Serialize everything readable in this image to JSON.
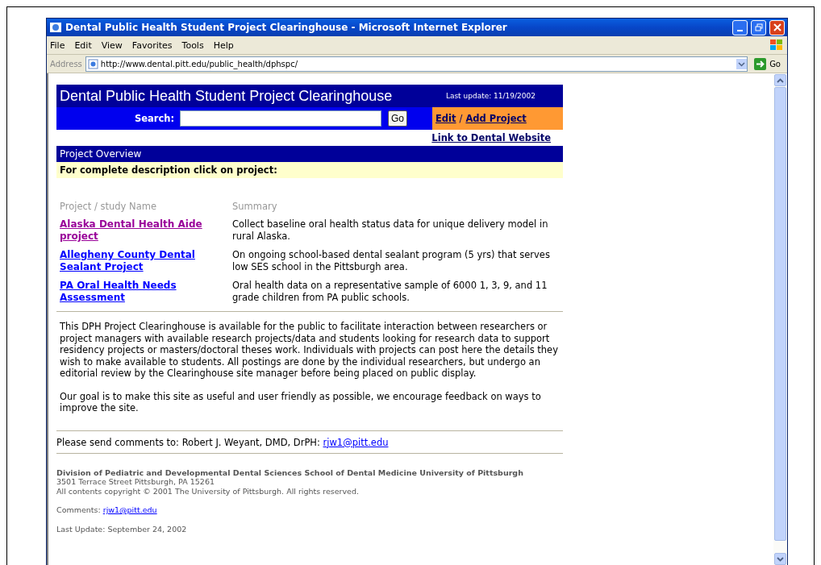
{
  "window": {
    "title": "Dental Public Health Student Project Clearinghouse - Microsoft Internet Explorer",
    "menu": [
      "File",
      "Edit",
      "View",
      "Favorites",
      "Tools",
      "Help"
    ],
    "address_label": "Address",
    "url": "http://www.dental.pitt.edu/public_health/dphspc/",
    "go": "Go"
  },
  "page": {
    "title": "Dental Public Health Student Project Clearinghouse",
    "last_update": "Last update: 11/19/2002",
    "search_label": "Search:",
    "search_button": "Go",
    "edit_link": "Edit",
    "separator": "/",
    "add_link": "Add Project",
    "website_link": "Link to Dental Website",
    "overview": "Project Overview",
    "instruction": "For complete description click on project:",
    "columns": [
      "Project / study Name",
      "Summary"
    ],
    "projects": [
      {
        "name": "Alaska Dental Health Aide project",
        "summary": "Collect baseline oral health status data for unique delivery model in rural Alaska.",
        "visited": true
      },
      {
        "name": "Allegheny County Dental Sealant Project",
        "summary": "On ongoing school-based dental sealant program (5 yrs) that serves low SES school in the Pittsburgh area.",
        "visited": false
      },
      {
        "name": "PA Oral Health Needs Assessment",
        "summary": "Oral health data on a representative sample of 6000 1, 3, 9, and 11 grade children from PA public schools.",
        "visited": false
      }
    ],
    "paragraphs": [
      "This DPH Project Clearinghouse is available for the public to facilitate interaction between researchers or project managers with available research projects/data and students looking for research data to support residency projects or masters/doctoral theses work. Individuals with projects can post here the details they wish to make available to students. All postings are done by the individual researchers, but undergo an editorial review by the Clearinghouse site manager before being placed on public display.",
      "Our goal is to make this site as useful and user friendly as possible, we encourage feedback on ways to improve the site."
    ],
    "contact": {
      "text": "Please send comments to: Robert J. Weyant, DMD, DrPH:",
      "email": "rjw1@pitt.edu"
    },
    "footer": {
      "org": "Division of Pediatric and Developmental Dental Sciences School of Dental Medicine University of Pittsburgh",
      "address": "3501 Terrace Street Pittsburgh, PA 15261",
      "copyright": "All contents copyright © 2001 The University of Pittsburgh. All rights reserved.",
      "comments_label": "Comments:",
      "email": "rjw1@pitt.edu",
      "last_update": "Last Update: September 24, 2002"
    }
  }
}
